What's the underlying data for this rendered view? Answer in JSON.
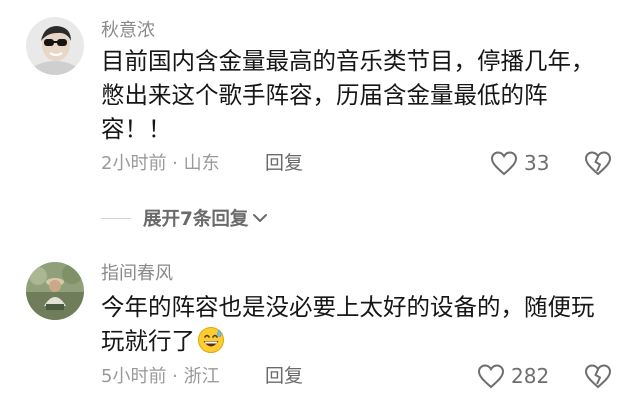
{
  "comments": [
    {
      "username": "秋意浓",
      "text": "目前国内含金量最高的音乐类节目，停播几年，憋出来这个歌手阵容，历届含金量最低的阵容！！",
      "time_location": "2小时前 · 山东",
      "reply_label": "回复",
      "likes": "33"
    },
    {
      "username": "指间春风",
      "text": "今年的阵容也是没必要上太好的设备的，随便玩玩就行了",
      "emoji": "grinning-sweat-emoji",
      "time_location": "5小时前 · 浙江",
      "reply_label": "回复",
      "likes": "282"
    }
  ],
  "expand_replies_label": "展开7条回复",
  "colors": {
    "text": "#161616",
    "meta": "#9a9a9a",
    "username": "#8a8a8a",
    "icon": "#6e6e6e"
  }
}
